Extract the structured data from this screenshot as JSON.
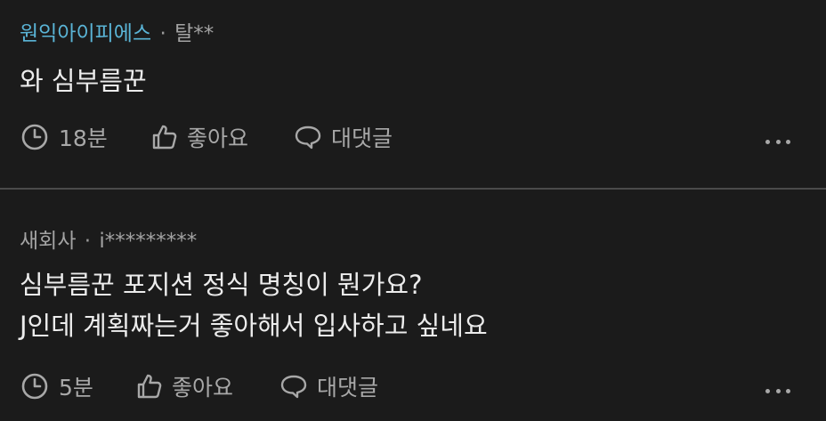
{
  "comments": [
    {
      "company": "원익아이피에스",
      "separator": "·",
      "author": "탈**",
      "text_lines": [
        "와 심부름꾼"
      ],
      "time": "18분",
      "like_label": "좋아요",
      "reply_label": "대댓글",
      "more_icon": "more-horizontal-icon"
    },
    {
      "company": "새회사",
      "separator": "·",
      "author": "i*********",
      "text_lines": [
        "심부름꾼 포지션 정식 명칭이 뭔가요?",
        "J인데 계획짜는거 좋아해서 입사하고 싶네요"
      ],
      "time": "5분",
      "like_label": "좋아요",
      "reply_label": "대댓글",
      "more_icon": "more-horizontal-icon"
    }
  ],
  "colors": {
    "background": "#1b1b1b",
    "company_link": "#5ab4d6",
    "muted": "#a8a8a8",
    "text": "#ececec",
    "divider": "#4a4a4a"
  }
}
